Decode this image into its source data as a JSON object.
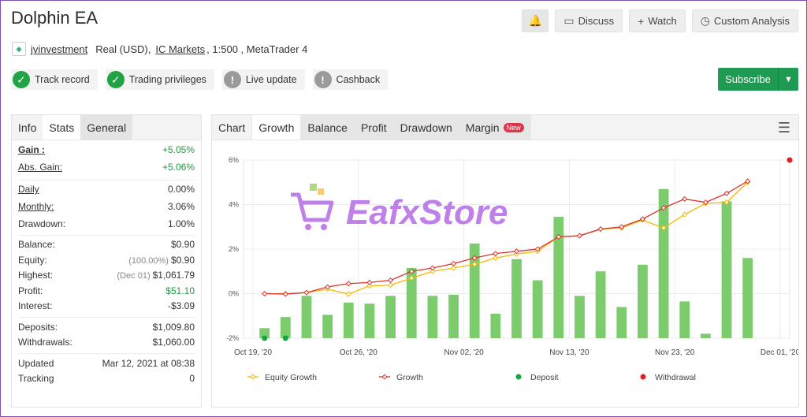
{
  "title": "Dolphin EA",
  "header_buttons": {
    "discuss": "Discuss",
    "watch": "Watch",
    "custom_analysis": "Custom Analysis"
  },
  "subtitle": {
    "user": "jvinvestment",
    "account_type": "Real (USD),",
    "broker": "IC Markets",
    "leverage_platform": ", 1:500 , MetaTrader 4"
  },
  "badges": [
    "Track record",
    "Trading privileges",
    "Live update",
    "Cashback"
  ],
  "subscribe": "Subscribe",
  "left_tabs": [
    "Info",
    "Stats",
    "General"
  ],
  "stats": {
    "gain": {
      "label": "Gain :",
      "value": "+5.05%"
    },
    "abs_gain": {
      "label": "Abs. Gain:",
      "value": "+5.06%"
    },
    "daily": {
      "label": "Daily",
      "value": "0.00%"
    },
    "monthly": {
      "label": "Monthly:",
      "value": "3.06%"
    },
    "drawdown": {
      "label": "Drawdown:",
      "value": "1.00%"
    },
    "balance": {
      "label": "Balance:",
      "value": "$0.90"
    },
    "equity": {
      "label": "Equity:",
      "note": "(100.00%)",
      "value": "$0.90"
    },
    "highest": {
      "label": "Highest:",
      "note": "(Dec 01)",
      "value": "$1,061.79"
    },
    "profit": {
      "label": "Profit:",
      "value": "$51.10"
    },
    "interest": {
      "label": "Interest:",
      "value": "-$3.09"
    },
    "deposits": {
      "label": "Deposits:",
      "value": "$1,009.80"
    },
    "withdrawals": {
      "label": "Withdrawals:",
      "value": "$1,060.00"
    },
    "updated": {
      "label": "Updated",
      "value": "Mar 12, 2021 at 08:38"
    },
    "tracking": {
      "label": "Tracking",
      "value": "0"
    }
  },
  "right_tabs": [
    "Chart",
    "Growth",
    "Balance",
    "Profit",
    "Drawdown",
    "Margin"
  ],
  "new_badge": "New",
  "watermark": "EafxStore",
  "colors": {
    "green": "#1e9a52",
    "bar": "#7ccc6e",
    "equity_line": "#f5b700",
    "growth_line": "#d9342b",
    "deposit": "#13a83b",
    "withdrawal": "#e02020"
  },
  "chart_data": {
    "type": "bar",
    "ylim": [
      -2,
      6
    ],
    "y_ticks": [
      "6%",
      "4%",
      "2%",
      "0%",
      "-2%"
    ],
    "x_tick_labels": [
      "Oct 19, '20",
      "Oct 26, '20",
      "Nov 02, '20",
      "Nov 13, '20",
      "Nov 23, '20",
      "Dec 01, '20"
    ],
    "bars": [
      -1.55,
      -1.05,
      -0.1,
      -0.95,
      -0.4,
      -0.45,
      -0.1,
      1.15,
      -0.1,
      -0.05,
      2.25,
      -0.9,
      1.55,
      0.6,
      3.45,
      -0.1,
      1.0,
      -0.6,
      1.3,
      4.7,
      -0.35,
      -1.8,
      4.15,
      1.6
    ],
    "series": [
      {
        "name": "Equity Growth",
        "values": [
          0.0,
          0.0,
          0.05,
          0.2,
          -0.02,
          0.35,
          0.38,
          0.7,
          1.0,
          1.15,
          1.32,
          1.6,
          1.78,
          1.9,
          2.55,
          2.6,
          2.9,
          2.95,
          3.3,
          2.95,
          3.55,
          4.05,
          4.1,
          5.0
        ]
      },
      {
        "name": "Growth",
        "values": [
          0.0,
          -0.02,
          0.05,
          0.3,
          0.45,
          0.5,
          0.6,
          1.0,
          1.15,
          1.35,
          1.6,
          1.8,
          1.9,
          2.0,
          2.55,
          2.6,
          2.9,
          3.0,
          3.35,
          3.85,
          4.25,
          4.1,
          4.5,
          5.05
        ]
      }
    ],
    "legend": [
      "Equity Growth",
      "Growth",
      "Deposit",
      "Withdrawal"
    ],
    "deposits_at": [
      0,
      1
    ],
    "withdrawals_at": [
      25
    ]
  }
}
